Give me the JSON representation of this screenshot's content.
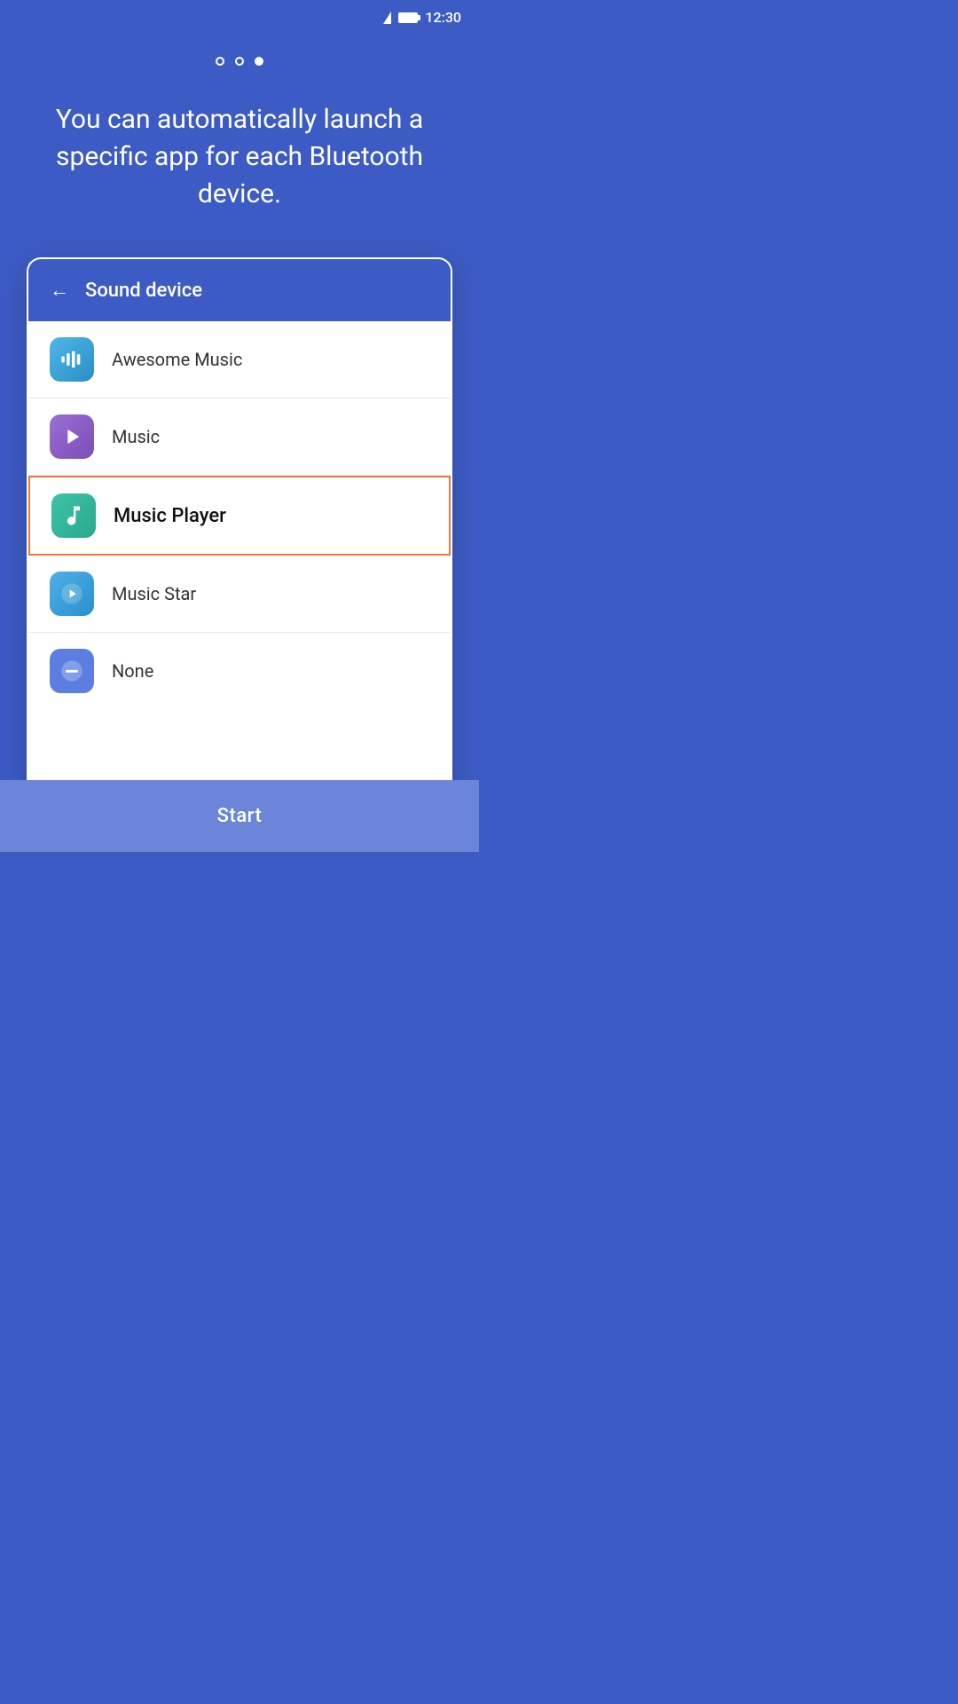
{
  "statusBar": {
    "time": "12:30"
  },
  "pageIndicators": [
    {
      "active": false
    },
    {
      "active": false
    },
    {
      "active": true
    }
  ],
  "headline": "You can automatically launch a specific app for each Bluetooth device.",
  "card": {
    "header": {
      "backLabel": "←",
      "title": "Sound device"
    },
    "items": [
      {
        "id": "awesome-music",
        "label": "Awesome Music",
        "iconType": "blue-wave",
        "selected": false
      },
      {
        "id": "music",
        "label": "Music",
        "iconType": "purple-play",
        "selected": false
      },
      {
        "id": "music-player",
        "label": "Music Player",
        "iconType": "teal-music",
        "selected": true
      },
      {
        "id": "music-star",
        "label": "Music Star",
        "iconType": "light-blue-play",
        "selected": false
      },
      {
        "id": "none",
        "label": "None",
        "iconType": "blue-minus",
        "selected": false
      }
    ]
  },
  "startButton": {
    "label": "Start"
  }
}
